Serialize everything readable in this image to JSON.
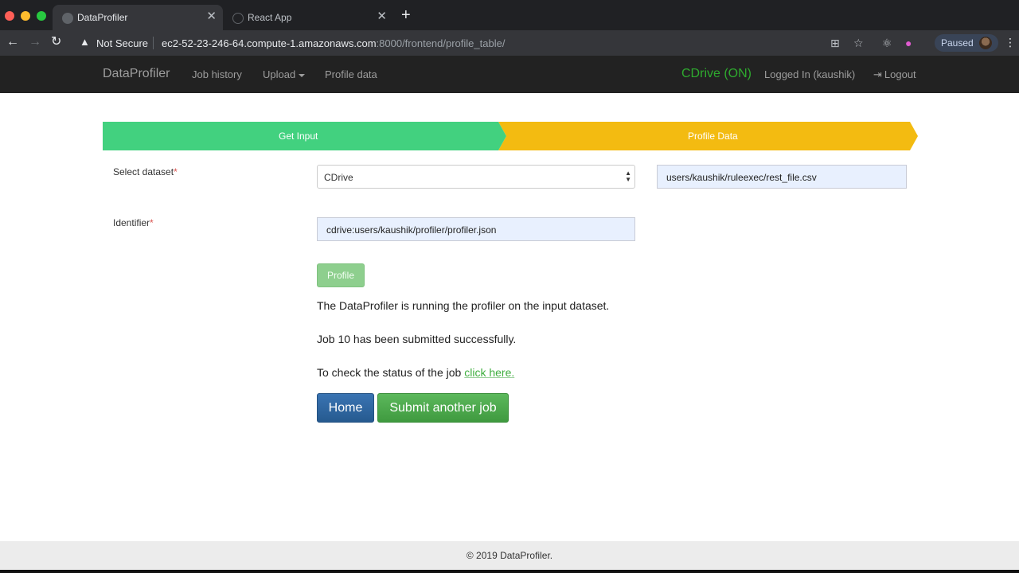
{
  "browser": {
    "tabs": [
      {
        "title": "DataProfiler",
        "active": true
      },
      {
        "title": "React App",
        "active": false
      }
    ],
    "security_label": "Not Secure",
    "url_host": "ec2-52-23-246-64.compute-1.amazonaws.com",
    "url_path": ":8000/frontend/profile_table/",
    "profile_status": "Paused"
  },
  "navbar": {
    "brand": "DataProfiler",
    "links": [
      "Job history",
      "Upload",
      "Profile data"
    ],
    "cdrive_status": "CDrive (ON)",
    "cdrive_color": "#2eaa2e",
    "user": "Logged In (kaushik)",
    "logout": "Logout"
  },
  "steps": [
    {
      "label": "Get Input",
      "color": "#42d17f"
    },
    {
      "label": "Profile Data",
      "color": "#f3bb11"
    }
  ],
  "form": {
    "dataset_label": "Select dataset",
    "required_mark": "*",
    "dataset_selected": "CDrive",
    "dataset_path": "users/kaushik/ruleexec/rest_file.csv",
    "identifier_label": "Identifier",
    "identifier_value": "cdrive:users/kaushik/profiler/profiler.json",
    "profile_button": "Profile"
  },
  "messages": {
    "running": "The DataProfiler is running the profiler on the input dataset.",
    "submitted": "Job 10 has been submitted successfully.",
    "status_prefix": "To check the status of the job ",
    "status_link": "click here."
  },
  "actions": {
    "home": "Home",
    "submit_another": "Submit another job"
  },
  "footer": {
    "text": "© 2019 DataProfiler."
  }
}
